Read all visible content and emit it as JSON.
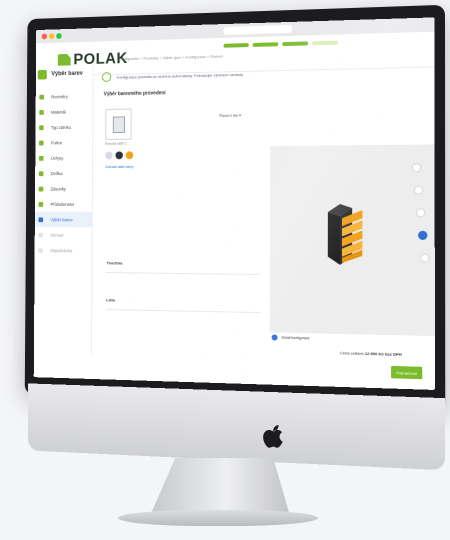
{
  "app": {
    "logo_text": "POLAK",
    "breadcrumb": "Konfigurátor  >  Produkty  >  Výběr typu  >  Konfigurace  >  Shrnutí"
  },
  "notice": {
    "text": "Konfigurace produktu je uložena automaticky. Pokračujte výběrem varianty."
  },
  "sidebar": {
    "header_label": "Výběr barev",
    "items": [
      {
        "label": "Rozměry",
        "state": "done"
      },
      {
        "label": "Materiál",
        "state": "done"
      },
      {
        "label": "Typ zámku",
        "state": "done"
      },
      {
        "label": "Police",
        "state": "done"
      },
      {
        "label": "Úchyty",
        "state": "done"
      },
      {
        "label": "Dvířka",
        "state": "done"
      },
      {
        "label": "Zásuvky",
        "state": "done"
      },
      {
        "label": "Příslušenství",
        "state": "done"
      },
      {
        "label": "Výběr barev",
        "state": "active"
      },
      {
        "label": "Shrnutí",
        "state": "todo"
      },
      {
        "label": "Objednávka",
        "state": "todo"
      }
    ]
  },
  "main": {
    "section_title": "Výběr barevného provedení",
    "variant_label": "Kovová skříň 1",
    "sort_label": "Řazení dle",
    "color_link": "Zobrazit další barvy",
    "fields": [
      {
        "label": "Tloušťka"
      },
      {
        "label": "Lišta"
      }
    ],
    "swatches": [
      "#d9dbe0",
      "#2b3340",
      "#f2a21c"
    ]
  },
  "preview": {
    "options_link": "Detail konfigurace",
    "price_prefix": "Cena celkem",
    "price_value": "12 800 Kč bez DPH",
    "continue_label": "Pokračovat"
  },
  "colors": {
    "brand_green": "#7dbb2e",
    "accent_blue": "#2f6fd6",
    "cabinet_body": "#2c2c2e",
    "cabinet_drawer": "#f2a21c"
  }
}
